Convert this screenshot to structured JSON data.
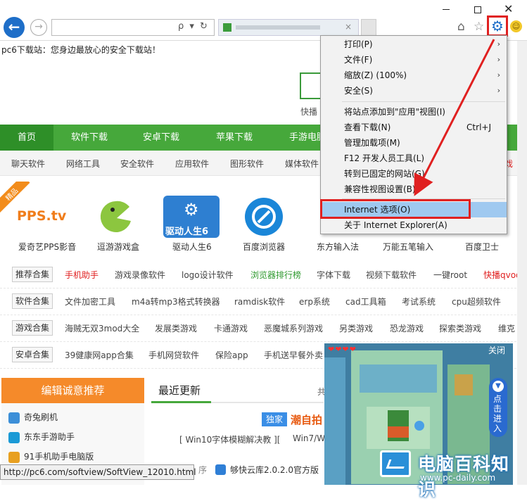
{
  "browser": {
    "tab_close": "×",
    "window_close": "✕",
    "tagline": "pc6下载站：您身边最放心的安全下载站！",
    "addr_icons": "ρ ▾ ↻"
  },
  "search": {
    "hot_label": "快播"
  },
  "nav": {
    "items": [
      "首页",
      "软件下载",
      "安卓下载",
      "苹果下载",
      "手游电脑"
    ],
    "sub_items": [
      "聊天软件",
      "网络工具",
      "安全软件",
      "应用软件",
      "图形软件",
      "媒体软件",
      "游戏"
    ]
  },
  "apps": {
    "ribbon": "精品",
    "items": [
      {
        "name": "爱奇艺PPS影音",
        "color": "#ffffff"
      },
      {
        "name": "逗游游戏盒",
        "color": "#8cc63f"
      },
      {
        "name": "驱动人生6",
        "color": "#2e7fd1"
      },
      {
        "name": "百度浏览器",
        "color": "#1a86d8"
      },
      {
        "name": "东方输入法",
        "color": "#f2f2f2"
      },
      {
        "name": "万能五笔输入",
        "color": "#f2f2f2"
      },
      {
        "name": "百度卫士",
        "color": "#f2f2f2"
      }
    ],
    "pps_logo": "PPS.tv",
    "driver_logo": "驱动人生6"
  },
  "tag_rows": [
    {
      "head": "推荐合集",
      "tags": [
        "手机助手",
        "游戏录像软件",
        "logo设计软件",
        "浏览器排行榜",
        "字体下载",
        "视频下载软件",
        "一键root",
        "快播qvod"
      ]
    },
    {
      "head": "软件合集",
      "tags": [
        "文件加密工具",
        "m4a转mp3格式转换器",
        "ramdisk软件",
        "erp系统",
        "cad工具箱",
        "考试系统",
        "cpu超频软件"
      ]
    },
    {
      "head": "游戏合集",
      "tags": [
        "海贼无双3mod大全",
        "发展类游戏",
        "卡通游戏",
        "恶魔城系列游戏",
        "另类游戏",
        "恐龙游戏",
        "探索类游戏",
        "维克"
      ]
    },
    {
      "head": "安卓合集",
      "tags": [
        "39健康网app合集",
        "手机网贷软件",
        "保险app",
        "手机送早餐外卖"
      ]
    }
  ],
  "recommend": {
    "title": "编辑诚意推荐",
    "items": [
      "奇兔刷机",
      "东东手游助手",
      "91手机助手电脑版"
    ]
  },
  "latest": {
    "title": "最近更新",
    "gong": "共",
    "badge": "独家",
    "headline": "潮自拍",
    "win10": "[ Win10字体模糊解决教 ][",
    "win7": "Win7/W",
    "xu": "序",
    "yun": "够快云库2.0.2.0官方版"
  },
  "status_bar": "http://pc6.com/softview/SoftView_12010.html",
  "game": {
    "close": "关闭",
    "hearts": "❤❤❤❤",
    "side_text": "点击进入",
    "side_arrow": "▼"
  },
  "watermark": {
    "title": "电脑百科知识",
    "url": "www.pc-daily.com"
  },
  "tools_menu": {
    "items": [
      {
        "label": "打印(P)",
        "arrow": "›"
      },
      {
        "label": "文件(F)",
        "arrow": "›"
      },
      {
        "label": "缩放(Z) (100%)",
        "arrow": "›"
      },
      {
        "label": "安全(S)",
        "arrow": "›"
      },
      {
        "label": "将站点添加到\"应用\"视图(I)"
      },
      {
        "label": "查看下载(N)",
        "shortcut": "Ctrl+J"
      },
      {
        "label": "管理加载项(M)"
      },
      {
        "label": "F12 开发人员工具(L)"
      },
      {
        "label": "转到已固定的网站(G)"
      },
      {
        "label": "兼容性视图设置(B)"
      },
      {
        "label": "Internet 选项(O)"
      },
      {
        "label": "关于 Internet Explorer(A)"
      }
    ]
  },
  "colors": {
    "nav_green": "#46a83b",
    "annotation_red": "#e02020",
    "menu_highlight": "#9fc9f0",
    "ie_blue": "#1e6ec8",
    "orange": "#f58a2a"
  }
}
